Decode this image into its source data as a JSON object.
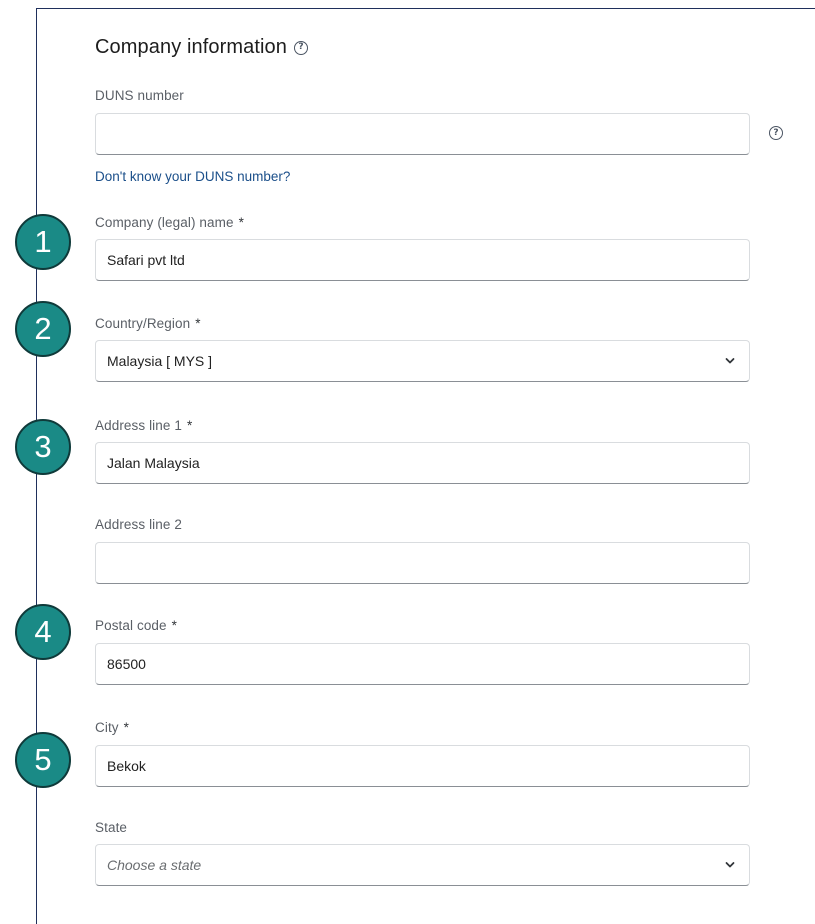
{
  "section": {
    "title": "Company information"
  },
  "duns": {
    "label": "DUNS number",
    "value": "",
    "link": "Don't know your DUNS number?"
  },
  "fields": [
    {
      "label": "Company (legal) name",
      "required": "*",
      "value": "Safari pvt ltd",
      "badge": "1"
    },
    {
      "label": "Country/Region",
      "required": "*",
      "value": "Malaysia [ MYS ]",
      "badge": "2"
    },
    {
      "label": "Address line 1",
      "required": "*",
      "value": "Jalan Malaysia",
      "badge": "3"
    },
    {
      "label": "Address line 2",
      "value": ""
    },
    {
      "label": "Postal code",
      "required": "*",
      "value": "86500",
      "badge": "4"
    },
    {
      "label": "City",
      "required": "*",
      "value": "Bekok",
      "badge": "5"
    },
    {
      "label": "State",
      "placeholder": "Choose a state"
    }
  ],
  "icons": {
    "help": "help-circle-icon",
    "dropdown": "chevron-down-icon"
  },
  "colors": {
    "badge": "#1a8a86",
    "link": "#1b4f8a",
    "frame": "#1f2f5b"
  }
}
